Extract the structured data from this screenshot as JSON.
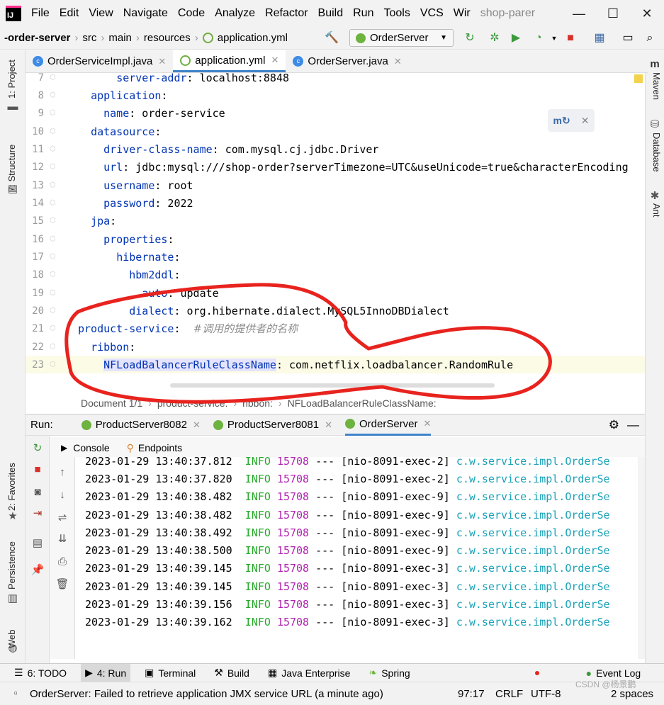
{
  "menubar": {
    "items": [
      "File",
      "Edit",
      "View",
      "Navigate",
      "Code",
      "Analyze",
      "Refactor",
      "Build",
      "Run",
      "Tools",
      "VCS",
      "Wir"
    ],
    "project_name": "shop-parer"
  },
  "navbar": {
    "crumbs": [
      "-order-server",
      "src",
      "main",
      "resources",
      "application.yml"
    ],
    "run_config": "OrderServer"
  },
  "tabs": [
    {
      "label": "OrderServiceImpl.java"
    },
    {
      "label": "application.yml"
    },
    {
      "label": "OrderServer.java"
    }
  ],
  "left_tools": {
    "project": "1: Project",
    "structure": "7: Structure",
    "favorites": "2: Favorites",
    "persistence": "Persistence",
    "web": "Web"
  },
  "right_tools": {
    "maven": "Maven",
    "database": "Database",
    "ant": "Ant"
  },
  "code_lines": [
    {
      "n": "7",
      "indent": "      ",
      "key": "server-addr",
      "val": " localhost:8848",
      "cmt": ""
    },
    {
      "n": "8",
      "indent": "  ",
      "key": "application",
      "val": "",
      "cmt": ""
    },
    {
      "n": "9",
      "indent": "    ",
      "key": "name",
      "val": " order-service",
      "cmt": ""
    },
    {
      "n": "10",
      "indent": "  ",
      "key": "datasource",
      "val": "",
      "cmt": ""
    },
    {
      "n": "11",
      "indent": "    ",
      "key": "driver-class-name",
      "val": " com.mysql.cj.jdbc.Driver",
      "cmt": ""
    },
    {
      "n": "12",
      "indent": "    ",
      "key": "url",
      "val": " jdbc:mysql:///shop-order?serverTimezone=UTC&useUnicode=true&characterEncoding",
      "cmt": ""
    },
    {
      "n": "13",
      "indent": "    ",
      "key": "username",
      "val": " root",
      "cmt": ""
    },
    {
      "n": "14",
      "indent": "    ",
      "key": "password",
      "val": " 2022",
      "cmt": ""
    },
    {
      "n": "15",
      "indent": "  ",
      "key": "jpa",
      "val": "",
      "cmt": ""
    },
    {
      "n": "16",
      "indent": "    ",
      "key": "properties",
      "val": "",
      "cmt": ""
    },
    {
      "n": "17",
      "indent": "      ",
      "key": "hibernate",
      "val": "",
      "cmt": ""
    },
    {
      "n": "18",
      "indent": "        ",
      "key": "hbm2ddl",
      "val": "",
      "cmt": ""
    },
    {
      "n": "19",
      "indent": "          ",
      "key": "auto",
      "val": " update",
      "cmt": ""
    },
    {
      "n": "20",
      "indent": "        ",
      "key": "dialect",
      "val": " org.hibernate.dialect.MySQL5InnoDBDialect",
      "cmt": ""
    },
    {
      "n": "21",
      "indent": "",
      "key": "product-service",
      "val": "  ",
      "cmt": "#调用的提供者的名称"
    },
    {
      "n": "22",
      "indent": "  ",
      "key": "ribbon",
      "val": "",
      "cmt": ""
    },
    {
      "n": "23",
      "indent": "    ",
      "key": "NFLoadBalancerRuleClassName",
      "val": " com.netflix.loadbalancer.RandomRule",
      "cmt": ""
    }
  ],
  "editor_breadcrumb": [
    "Document 1/1",
    "product-service:",
    "ribbon:",
    "NFLoadBalancerRuleClassName:"
  ],
  "run_panel": {
    "label": "Run:",
    "tabs": [
      "ProductServer8082",
      "ProductServer8081",
      "OrderServer"
    ],
    "console_tab": "Console",
    "endpoints_tab": "Endpoints"
  },
  "log_lines": [
    {
      "ts": "2023-01-29 13:40:37.812",
      "lvl": "INFO",
      "pid": "15708",
      "sep": "---",
      "thread": "[nio-8091-exec-2]",
      "cls": "c.w.service.impl.OrderSe"
    },
    {
      "ts": "2023-01-29 13:40:37.820",
      "lvl": "INFO",
      "pid": "15708",
      "sep": "---",
      "thread": "[nio-8091-exec-2]",
      "cls": "c.w.service.impl.OrderSe"
    },
    {
      "ts": "2023-01-29 13:40:38.482",
      "lvl": "INFO",
      "pid": "15708",
      "sep": "---",
      "thread": "[nio-8091-exec-9]",
      "cls": "c.w.service.impl.OrderSe"
    },
    {
      "ts": "2023-01-29 13:40:38.482",
      "lvl": "INFO",
      "pid": "15708",
      "sep": "---",
      "thread": "[nio-8091-exec-9]",
      "cls": "c.w.service.impl.OrderSe"
    },
    {
      "ts": "2023-01-29 13:40:38.492",
      "lvl": "INFO",
      "pid": "15708",
      "sep": "---",
      "thread": "[nio-8091-exec-9]",
      "cls": "c.w.service.impl.OrderSe"
    },
    {
      "ts": "2023-01-29 13:40:38.500",
      "lvl": "INFO",
      "pid": "15708",
      "sep": "---",
      "thread": "[nio-8091-exec-9]",
      "cls": "c.w.service.impl.OrderSe"
    },
    {
      "ts": "2023-01-29 13:40:39.145",
      "lvl": "INFO",
      "pid": "15708",
      "sep": "---",
      "thread": "[nio-8091-exec-3]",
      "cls": "c.w.service.impl.OrderSe"
    },
    {
      "ts": "2023-01-29 13:40:39.145",
      "lvl": "INFO",
      "pid": "15708",
      "sep": "---",
      "thread": "[nio-8091-exec-3]",
      "cls": "c.w.service.impl.OrderSe"
    },
    {
      "ts": "2023-01-29 13:40:39.156",
      "lvl": "INFO",
      "pid": "15708",
      "sep": "---",
      "thread": "[nio-8091-exec-3]",
      "cls": "c.w.service.impl.OrderSe"
    },
    {
      "ts": "2023-01-29 13:40:39.162",
      "lvl": "INFO",
      "pid": "15708",
      "sep": "---",
      "thread": "[nio-8091-exec-3]",
      "cls": "c.w.service.impl.OrderSe"
    }
  ],
  "bottom_tools": [
    "6: TODO",
    "4: Run",
    "Terminal",
    "Build",
    "Java Enterprise",
    "Spring",
    "Event Log"
  ],
  "status": {
    "message": "OrderServer: Failed to retrieve application JMX service URL (a minute ago)",
    "position": "97:17",
    "line_sep": "CRLF",
    "encoding": "UTF-8",
    "indent": "2 spaces",
    "watermark": "CSDN @杨景鹏"
  },
  "colors": {
    "annotation_red": "#e8231e",
    "accent": "#4083c9"
  }
}
